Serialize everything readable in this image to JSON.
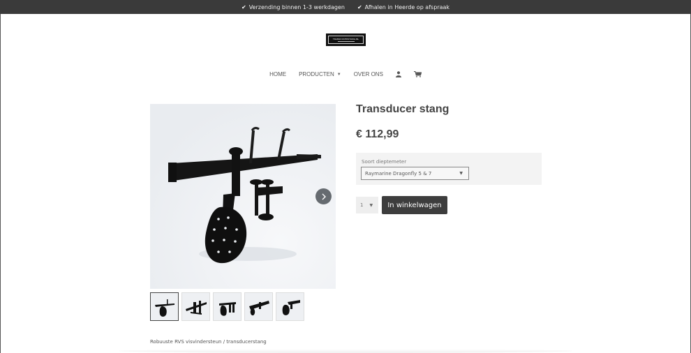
{
  "topbar": {
    "usps": [
      {
        "icon": "check-icon",
        "text": "Verzending binnen 1-3 werkdagen"
      },
      {
        "icon": "check-icon",
        "text": "Afhalen in Heerde op afspraak"
      }
    ]
  },
  "logo": {
    "text": "TRANSDUCERSTANG.NL"
  },
  "nav": {
    "home": "HOME",
    "producten": "PRODUCTEN",
    "over_ons": "OVER ONS",
    "account_icon": "user-icon",
    "cart_icon": "cart-icon"
  },
  "product": {
    "title": "Transducer stang",
    "price": "€ 112,99",
    "variant_label": "Soort dieptemeter",
    "variant_selected": "Raymarine Dragonfly 5 & 7",
    "quantity": "1",
    "add_to_cart": "In winkelwagen",
    "description": "Robuuste RVS visvindersteun / transducerstang"
  },
  "colors": {
    "topbar": "#3a3a3a",
    "button": "#3d3d3d",
    "variant_bg": "#f3f3f3"
  }
}
